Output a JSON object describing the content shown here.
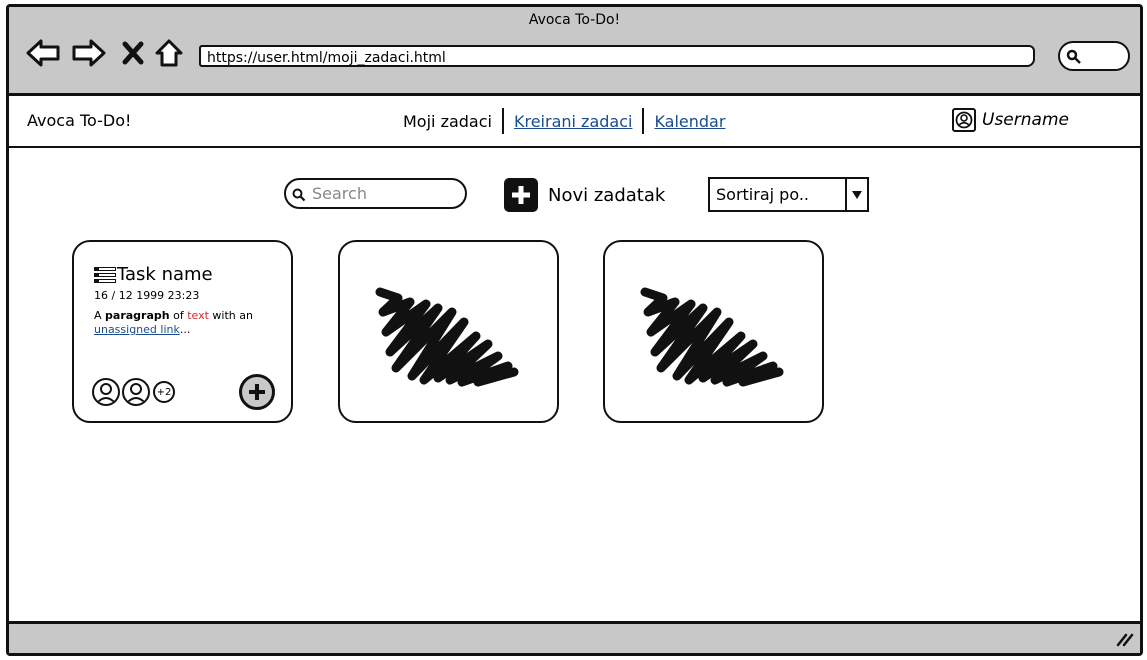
{
  "window": {
    "title": "Avoca To-Do!"
  },
  "browser": {
    "url": "https://user.html/moji_zadaci.html"
  },
  "nav": {
    "brand": "Avoca To-Do!",
    "items": [
      {
        "label": "Moji zadaci"
      },
      {
        "label": "Kreirani zadaci"
      },
      {
        "label": "Kalendar"
      }
    ],
    "username": "Username"
  },
  "toolbar": {
    "search_placeholder": "Search",
    "new_task_label": "Novi zadatak",
    "sort_label": "Sortiraj po.."
  },
  "tasks": [
    {
      "name": "Task name",
      "date": "16 / 12 1999 23:23",
      "desc_prefix": "A ",
      "desc_bold": "paragraph",
      "desc_of": " of ",
      "desc_red": "text",
      "desc_with": " with an",
      "desc_link": "unassigned link",
      "desc_ellipsis": "...",
      "extra_members": "+2"
    }
  ],
  "icons": {
    "back": "back-arrow-icon",
    "forward": "forward-arrow-icon",
    "stop": "close-icon",
    "home": "home-icon",
    "search": "search-icon",
    "user": "user-icon",
    "add": "plus-icon",
    "sort": "chevron-down-icon",
    "task": "list-icon",
    "placeholder": "scribble-image-icon",
    "resize": "resize-handle-icon"
  }
}
